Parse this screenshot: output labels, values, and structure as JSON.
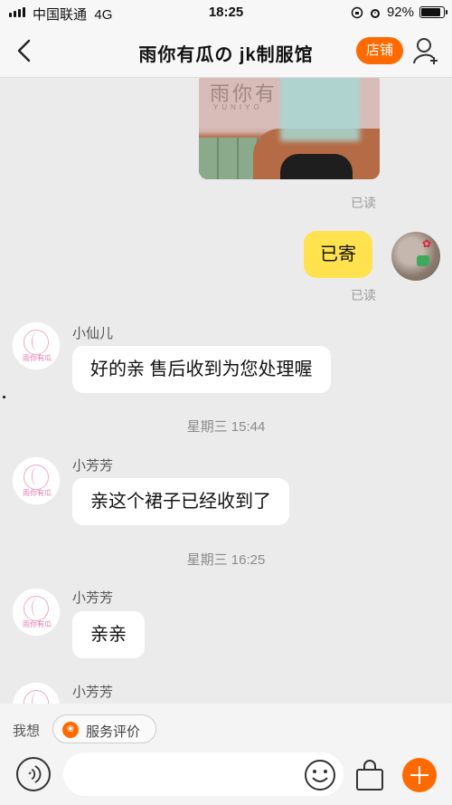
{
  "status_bar": {
    "carrier": "中国联通",
    "network": "4G",
    "time": "18:25",
    "battery": "92%",
    "battery_level": 0.92
  },
  "header": {
    "title": "雨你有瓜の jk制服馆",
    "shop_button": "店铺"
  },
  "image_message": {
    "brand_text": "雨你有",
    "brand_sub": "YUNIYO"
  },
  "messages": {
    "read_1": "已读",
    "self_bubble": "已寄",
    "read_2": "已读",
    "msg1_sender": "小仙儿",
    "msg1_text": "好的亲 售后收到为您处理喔",
    "ts1": "星期三 15:44",
    "msg2_sender": "小芳芳",
    "msg2_text": "亲这个裙子已经收到了",
    "ts2": "星期三 16:25",
    "msg3_sender": "小芳芳",
    "msg3_text": "亲亲",
    "msg4_sender": "小芳芳"
  },
  "shop_avatar_label": "雨你有瓜",
  "quick_bar": {
    "label": "我想",
    "chip": "服务评价"
  },
  "icons": [
    "back-arrow-icon",
    "profile-icon",
    "voice-icon",
    "emoji-icon",
    "shopping-bag-icon",
    "plus-icon",
    "service-icon"
  ],
  "colors": {
    "accent": "#ff6a00",
    "self_bubble": "#ffe24d",
    "background": "#ebebeb"
  }
}
